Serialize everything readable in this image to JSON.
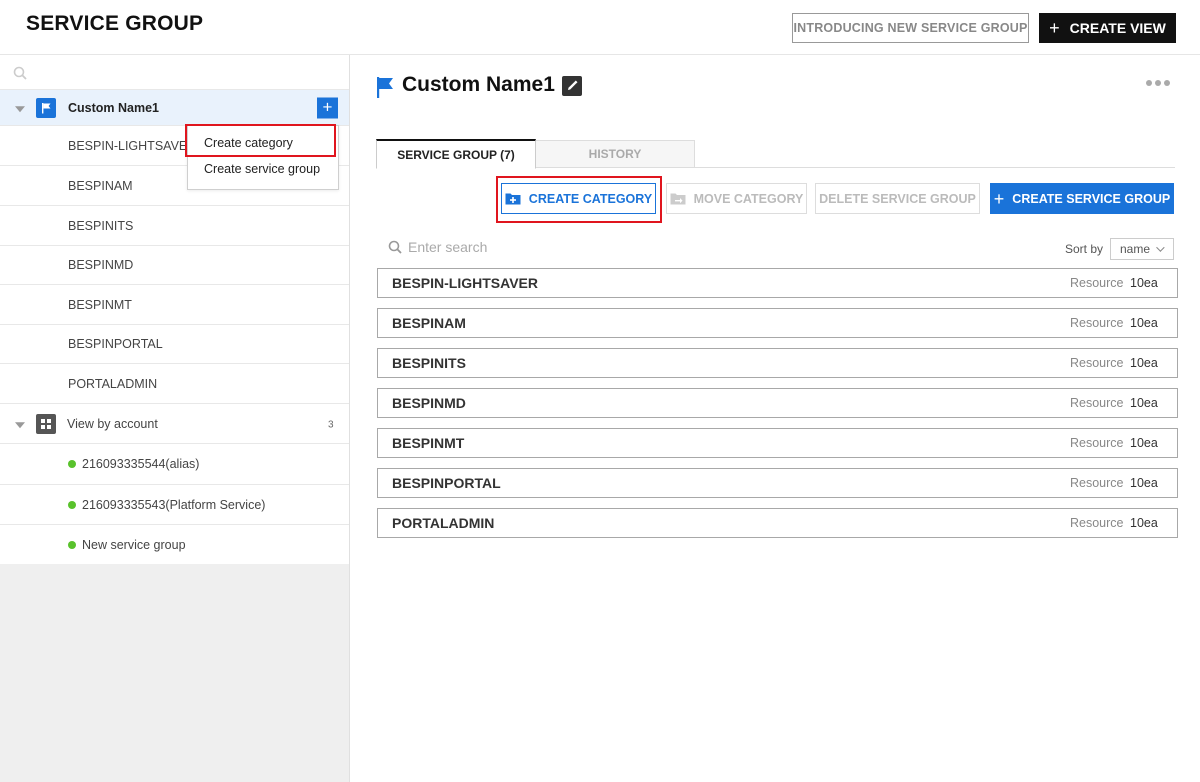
{
  "header": {
    "title": "SERVICE GROUP",
    "intro_button": "INTRODUCING NEW SERVICE GROUP",
    "create_view_button": "CREATE VIEW"
  },
  "sidebar": {
    "search_placeholder": "",
    "root": {
      "label": "Custom Name1",
      "icon": "flag-icon"
    },
    "children": [
      "BESPIN-LIGHTSAVER",
      "BESPINAM",
      "BESPINITS",
      "BESPINMD",
      "BESPINMT",
      "BESPINPORTAL",
      "PORTALADMIN"
    ],
    "account_group": {
      "label": "View by account",
      "count": "3",
      "icon": "grid-icon"
    },
    "accounts": [
      "216093335544(alias)",
      "216093335543(Platform Service)",
      "New service group"
    ],
    "status_color": "#59c22c"
  },
  "context_menu": {
    "items": [
      "Create category",
      "Create service group"
    ]
  },
  "main": {
    "title": "Custom Name1",
    "tabs": [
      {
        "label": "SERVICE GROUP (7)",
        "active": true
      },
      {
        "label": "HISTORY",
        "active": false
      }
    ],
    "actions": {
      "create_category": "CREATE CATEGORY",
      "move_category": "MOVE CATEGORY",
      "delete_service_group": "DELETE SERVICE GROUP",
      "create_service_group": "CREATE SERVICE GROUP"
    },
    "search_placeholder": "Enter search",
    "sort_label": "Sort by",
    "sort_value": "name",
    "rows": [
      {
        "name": "BESPIN-LIGHTSAVER",
        "resource_label": "Resource",
        "count": "10ea"
      },
      {
        "name": "BESPINAM",
        "resource_label": "Resource",
        "count": "10ea"
      },
      {
        "name": "BESPINITS",
        "resource_label": "Resource",
        "count": "10ea"
      },
      {
        "name": "BESPINMD",
        "resource_label": "Resource",
        "count": "10ea"
      },
      {
        "name": "BESPINMT",
        "resource_label": "Resource",
        "count": "10ea"
      },
      {
        "name": "BESPINPORTAL",
        "resource_label": "Resource",
        "count": "10ea"
      },
      {
        "name": "PORTALADMIN",
        "resource_label": "Resource",
        "count": "10ea"
      }
    ]
  },
  "colors": {
    "accent": "#1a73d9",
    "highlight": "#e0151e"
  }
}
